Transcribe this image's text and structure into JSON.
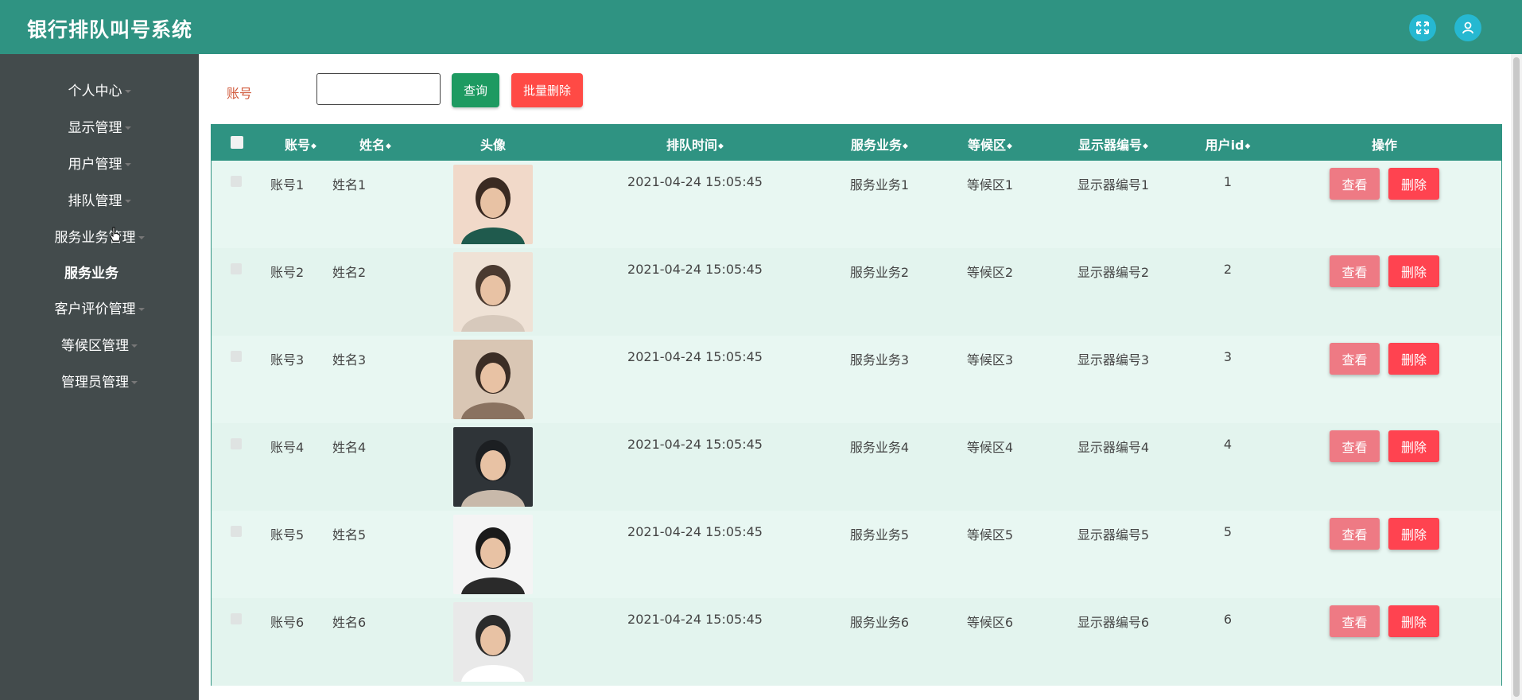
{
  "app": {
    "title": "银行排队叫号系统"
  },
  "header_icons": [
    {
      "name": "fullscreen-icon"
    },
    {
      "name": "user-icon"
    }
  ],
  "sidebar": {
    "items": [
      {
        "label": "个人中心",
        "has_caret": true
      },
      {
        "label": "显示管理",
        "has_caret": true
      },
      {
        "label": "用户管理",
        "has_caret": true
      },
      {
        "label": "排队管理",
        "has_caret": true
      },
      {
        "label": "服务业务管理",
        "has_caret": true
      },
      {
        "label": "服务业务",
        "has_caret": false,
        "sub": true
      },
      {
        "label": "客户评价管理",
        "has_caret": true
      },
      {
        "label": "等候区管理",
        "has_caret": true
      },
      {
        "label": "管理员管理",
        "has_caret": true
      }
    ]
  },
  "search": {
    "label": "账号",
    "value": "",
    "query_button": "查询",
    "batch_delete_button": "批量删除"
  },
  "table": {
    "columns": [
      {
        "label": "账号",
        "sortable": true
      },
      {
        "label": "姓名",
        "sortable": true
      },
      {
        "label": "头像",
        "sortable": false
      },
      {
        "label": "排队时间",
        "sortable": true
      },
      {
        "label": "服务业务",
        "sortable": true
      },
      {
        "label": "等候区",
        "sortable": true
      },
      {
        "label": "显示器编号",
        "sortable": true
      },
      {
        "label": "用户id",
        "sortable": true
      },
      {
        "label": "操作",
        "sortable": false
      }
    ],
    "sort_icon": "◆",
    "actions": {
      "view": "查看",
      "delete": "删除"
    },
    "rows": [
      {
        "account": "账号1",
        "name": "姓名1",
        "time": "2021-04-24 15:05:45",
        "service": "服务业务1",
        "area": "等候区1",
        "display": "显示器编号1",
        "uid": "1"
      },
      {
        "account": "账号2",
        "name": "姓名2",
        "time": "2021-04-24 15:05:45",
        "service": "服务业务2",
        "area": "等候区2",
        "display": "显示器编号2",
        "uid": "2"
      },
      {
        "account": "账号3",
        "name": "姓名3",
        "time": "2021-04-24 15:05:45",
        "service": "服务业务3",
        "area": "等候区3",
        "display": "显示器编号3",
        "uid": "3"
      },
      {
        "account": "账号4",
        "name": "姓名4",
        "time": "2021-04-24 15:05:45",
        "service": "服务业务4",
        "area": "等候区4",
        "display": "显示器编号4",
        "uid": "4"
      },
      {
        "account": "账号5",
        "name": "姓名5",
        "time": "2021-04-24 15:05:45",
        "service": "服务业务5",
        "area": "等候区5",
        "display": "显示器编号5",
        "uid": "5"
      },
      {
        "account": "账号6",
        "name": "姓名6",
        "time": "2021-04-24 15:05:45",
        "service": "服务业务6",
        "area": "等候区6",
        "display": "显示器编号6",
        "uid": "6"
      }
    ]
  },
  "colors": {
    "header": "#2f9382",
    "sidebar": "#434b4c",
    "row_bg": "#e6f6f1",
    "query_btn": "#1d9a61",
    "delete_btn": "#ff4350",
    "view_btn": "#ee7a84"
  }
}
